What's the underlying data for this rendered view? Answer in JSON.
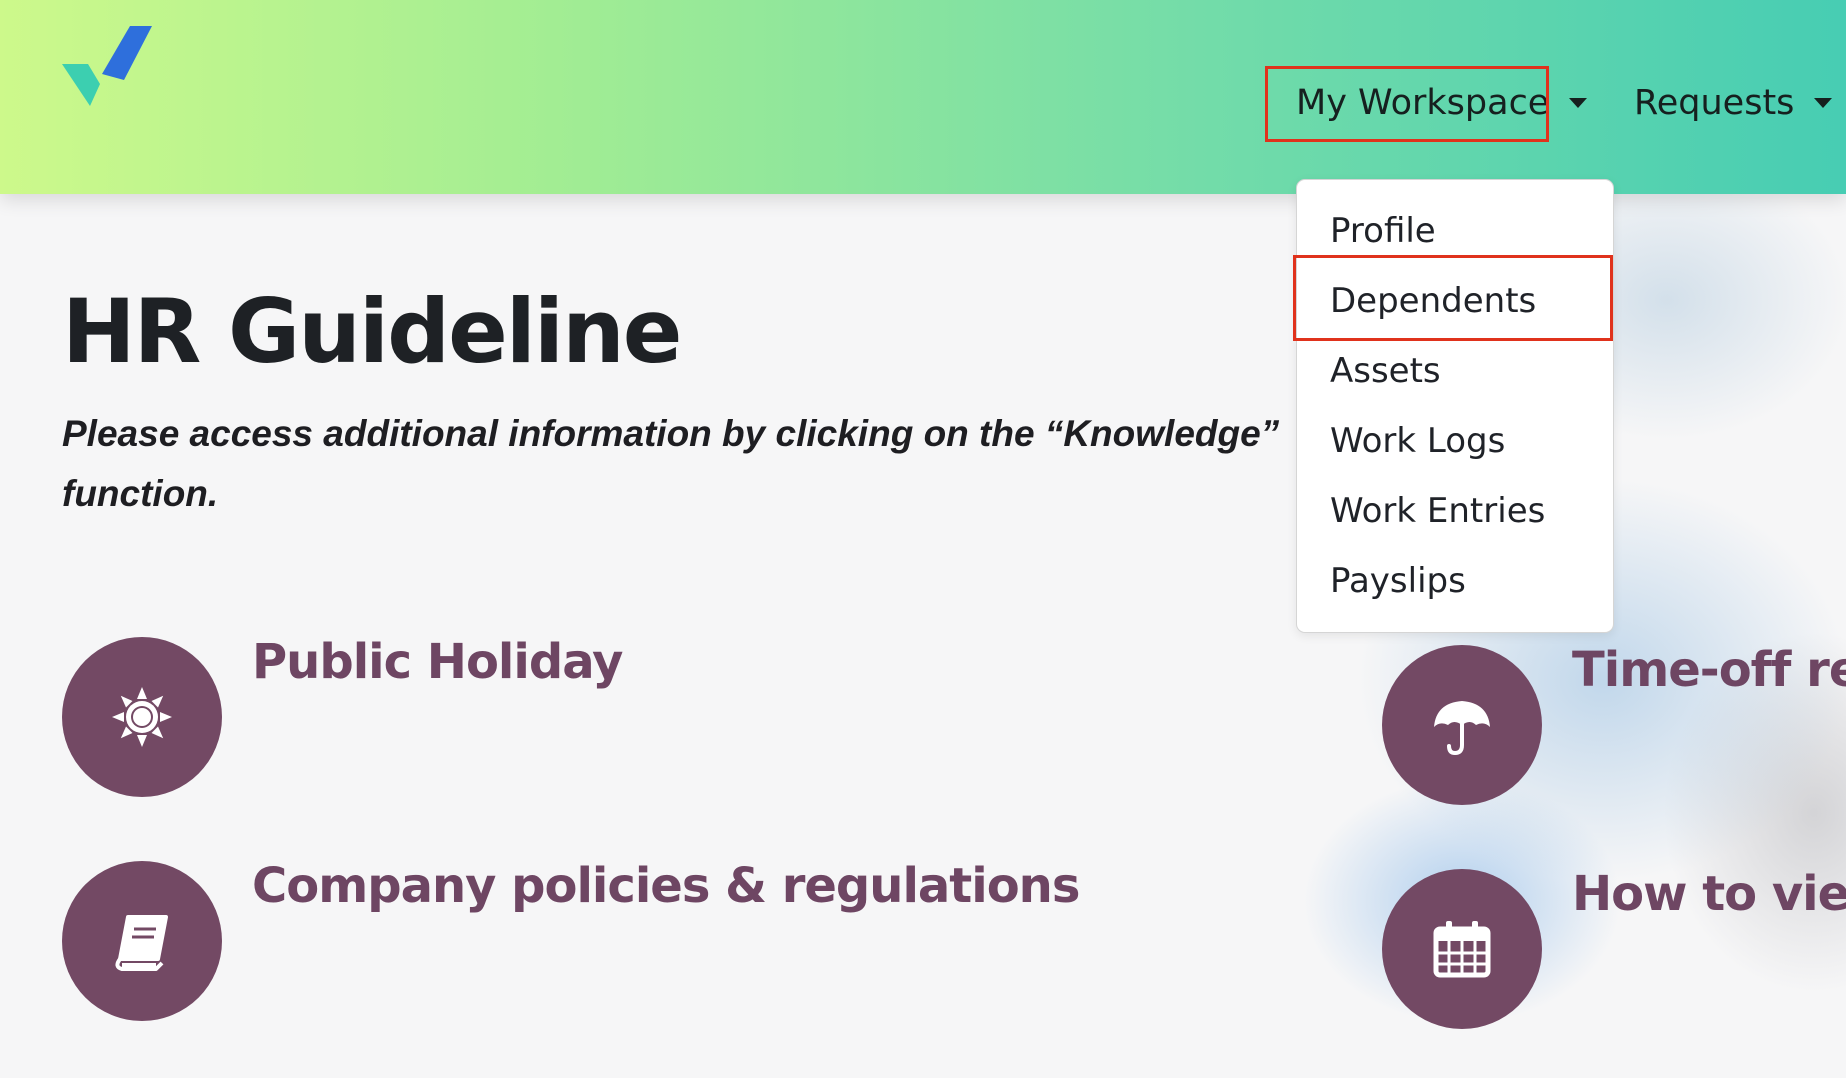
{
  "header": {
    "logo": "app-logo-checkmark",
    "nav": {
      "workspace_label": "My Workspace",
      "requests_label": "Requests"
    }
  },
  "dropdown": {
    "items": [
      {
        "label": "Profile"
      },
      {
        "label": "Dependents"
      },
      {
        "label": "Assets"
      },
      {
        "label": "Work Logs"
      },
      {
        "label": "Work Entries"
      },
      {
        "label": "Payslips"
      }
    ]
  },
  "main": {
    "title": "HR Guideline",
    "subtitle": "Please access additional information by clicking on the “Knowledge” function.",
    "cards": [
      {
        "title": "Public Holiday",
        "icon": "sun-icon"
      },
      {
        "title": "Company policies & regulations",
        "icon": "book-icon"
      },
      {
        "title": "Time-off re",
        "icon": "umbrella-icon"
      },
      {
        "title": "How to view",
        "icon": "calendar-icon"
      }
    ]
  },
  "colors": {
    "accent": "#734964",
    "highlight": "#e0321c",
    "header_gradient_start": "#cdf98b",
    "header_gradient_end": "#47cdb3"
  }
}
